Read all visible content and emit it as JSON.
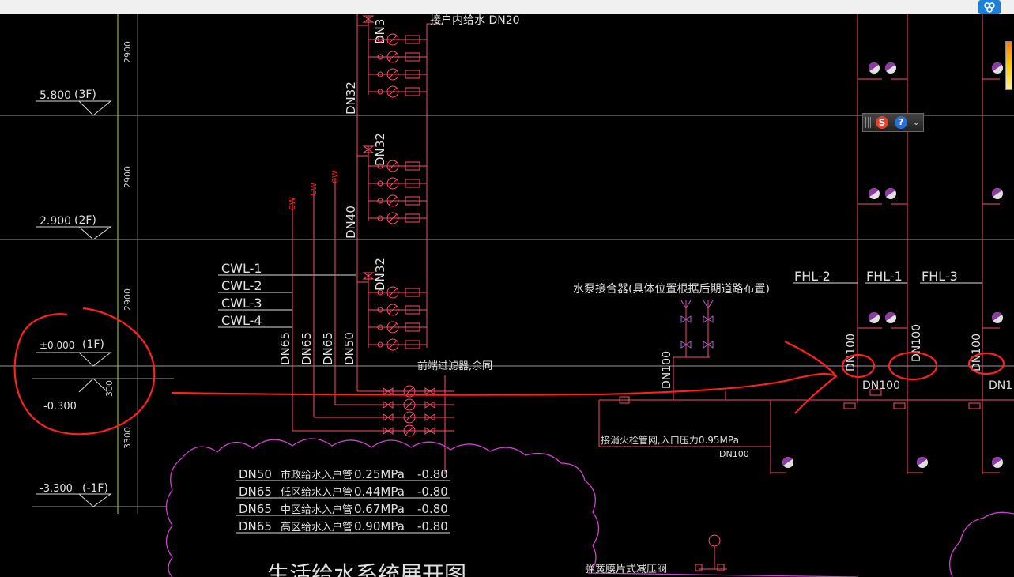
{
  "top_bar": {
    "icon": "cloud-logo-icon"
  },
  "floors": [
    {
      "level": "5.800",
      "floor": "(3F)"
    },
    {
      "level": "2.900",
      "floor": "(2F)"
    },
    {
      "level": "±0.000",
      "floor": "(1F)"
    },
    {
      "level": "-0.300",
      "floor": ""
    },
    {
      "level": "-3.300",
      "floor": "(-1F)"
    }
  ],
  "dimensions": [
    "2900",
    "2900",
    "2900",
    "300",
    "3300"
  ],
  "cwl_labels": [
    "CWL-1",
    "CWL-2",
    "CWL-3",
    "CWL-4"
  ],
  "cw_labels": [
    "CW",
    "CW",
    "CW"
  ],
  "riser_sizes": [
    "DN65",
    "DN65",
    "DN65",
    "DN50"
  ],
  "branch_sizes": [
    "DN3",
    "DN32",
    "DN32",
    "DN40",
    "DN32"
  ],
  "header_note": "接户内给水 DN20",
  "filter_note": "前端过滤器,余同",
  "pump_adapter_note": "水泵接合器(具体位置根据后期道路布置)",
  "fire_network_note": "接消火栓管网,入口压力0.95MPa",
  "dn100_labels": [
    "DN100",
    "DN100",
    "DN100",
    "DN100",
    "DN100",
    "DN1",
    "DN100"
  ],
  "fhl_labels": [
    "FHL-2",
    "FHL-1",
    "FHL-3"
  ],
  "legend_rows": [
    {
      "size": "DN50",
      "name": "市政给水入户管",
      "pressure": "0.25MPa",
      "elev": "-0.80"
    },
    {
      "size": "DN65",
      "name": "低区给水入户管",
      "pressure": "0.44MPa",
      "elev": "-0.80"
    },
    {
      "size": "DN65",
      "name": "中区给水入户管",
      "pressure": "0.67MPa",
      "elev": "-0.80"
    },
    {
      "size": "DN65",
      "name": "高区给水入户管",
      "pressure": "0.90MPa",
      "elev": "-0.80"
    }
  ],
  "diagram_title": "生活给水系统展开图",
  "reducer_note": "弹簧膜片式减压阀",
  "ime_toolbar": {
    "logo": "S",
    "help": "?",
    "arrow": "⌄"
  },
  "colors": {
    "background": "#000000",
    "pipe_red": "#ff4a6a",
    "grid_grey": "#9a9a9a",
    "dim_green": "#a8d060",
    "annotation_red": "#ff2020",
    "cloud_magenta": "#d040d0",
    "sprinkler_purple": "#8a3aa0"
  }
}
